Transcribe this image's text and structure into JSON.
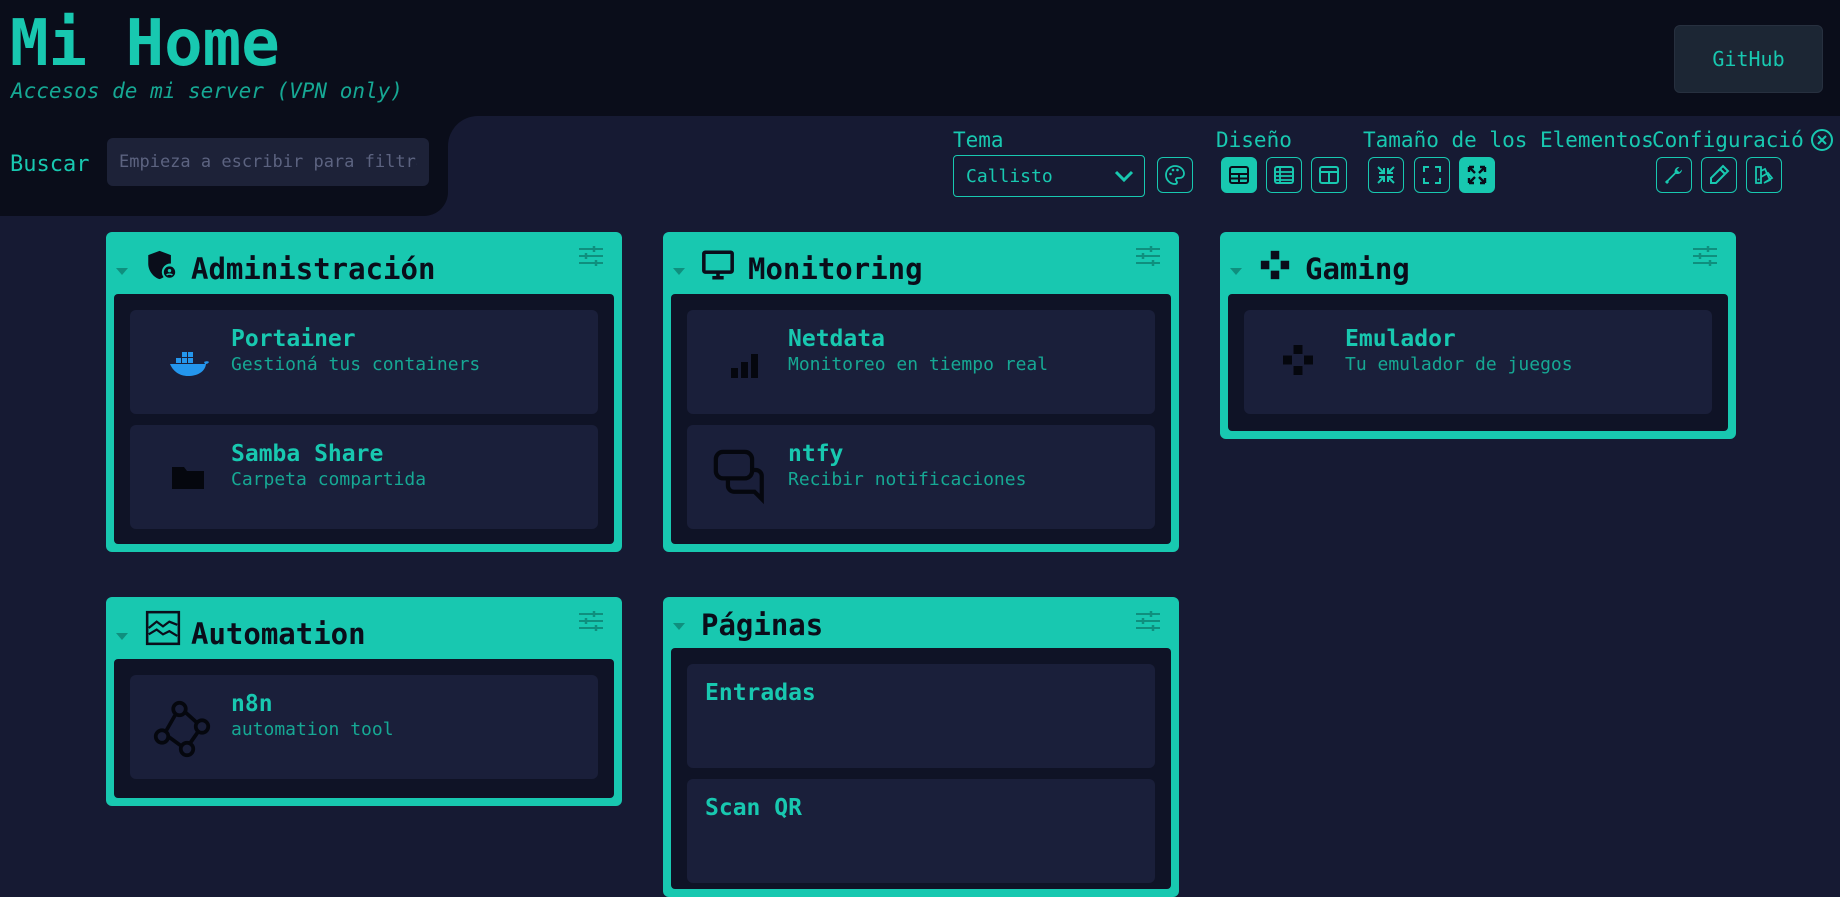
{
  "header": {
    "title": "Mi Home",
    "subtitle": "Accesos de mi server (VPN only)",
    "github_label": "GitHub"
  },
  "search": {
    "label": "Buscar",
    "placeholder": "Empieza a escribir para filtrar"
  },
  "settings": {
    "theme_label": "Tema",
    "theme_value": "Callisto",
    "layout_label": "Diseño",
    "size_label": "Tamaño de los Elementos",
    "config_label": "Configuración"
  },
  "sections": [
    {
      "title": "Administración",
      "icon": "shield-user-icon",
      "items": [
        {
          "title": "Portainer",
          "description": "Gestioná tus containers",
          "icon": "docker-icon"
        },
        {
          "title": "Samba Share",
          "description": "Carpeta compartida",
          "icon": "folder-icon"
        }
      ]
    },
    {
      "title": "Monitoring",
      "icon": "monitor-icon",
      "items": [
        {
          "title": "Netdata",
          "description": "Monitoreo en tiempo real",
          "icon": "signal-bars-icon"
        },
        {
          "title": "ntfy",
          "description": "Recibir notificaciones",
          "icon": "chat-bubbles-icon"
        }
      ]
    },
    {
      "title": "Gaming",
      "icon": "gamepad-icon",
      "items": [
        {
          "title": "Emulador",
          "description": "Tu emulador de juegos",
          "icon": "gamepad-icon"
        }
      ]
    },
    {
      "title": "Automation",
      "icon": "chart-area-icon",
      "items": [
        {
          "title": "n8n",
          "description": "automation tool",
          "icon": "workflow-nodes-icon"
        }
      ]
    },
    {
      "title": "Páginas",
      "items": [
        {
          "title": "Entradas"
        },
        {
          "title": "Scan QR"
        }
      ]
    }
  ],
  "colors": {
    "accent": "#18c8b0",
    "background": "#161a33",
    "header_bg": "#0a0d1a",
    "item_bg": "#1a1f3a"
  }
}
